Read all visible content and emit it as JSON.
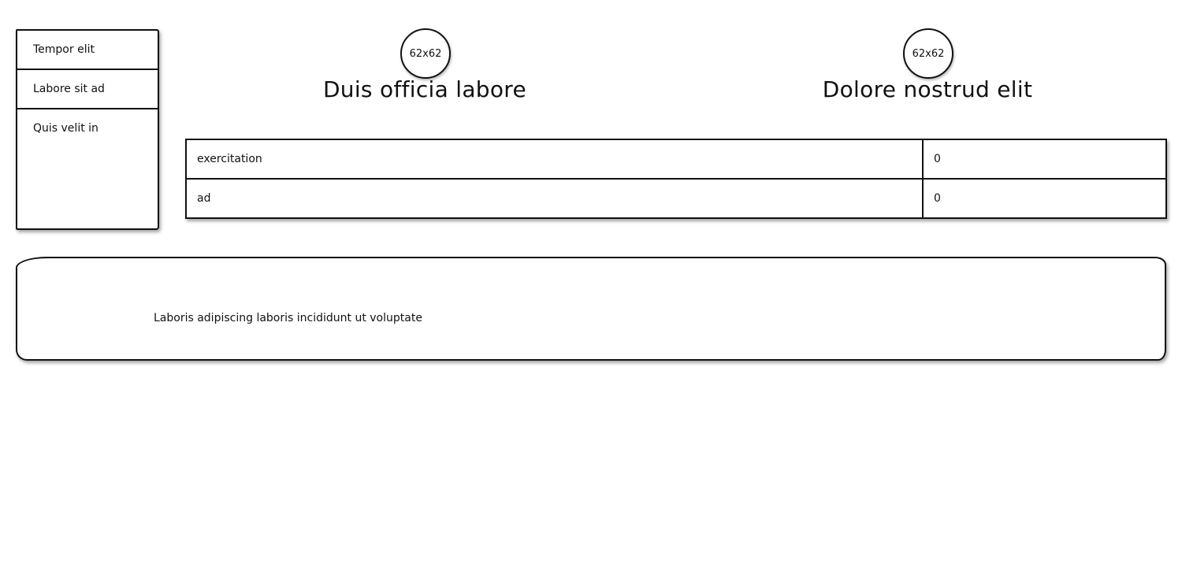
{
  "sidebar": {
    "items": [
      {
        "label": "Tempor elit"
      },
      {
        "label": "Labore sit ad"
      },
      {
        "label": "Quis velit in"
      }
    ]
  },
  "cards": [
    {
      "avatar_text": "62x62",
      "title": "Duis officia labore"
    },
    {
      "avatar_text": "62x62",
      "title": "Dolore nostrud elit"
    }
  ],
  "table": {
    "rows": [
      {
        "name": "exercitation",
        "value": "0"
      },
      {
        "name": "ad",
        "value": "0"
      }
    ]
  },
  "panel": {
    "text": "Laboris adipiscing laboris incididunt ut voluptate"
  }
}
